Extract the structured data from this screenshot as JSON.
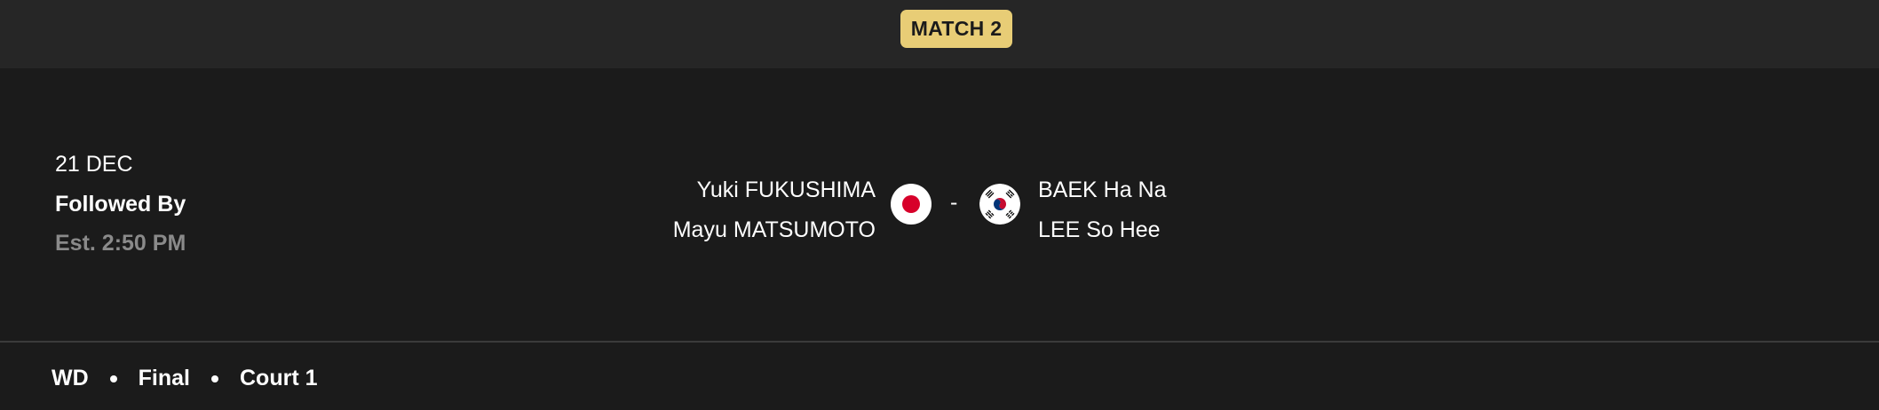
{
  "header": {
    "badge_label": "MATCH 2",
    "badge_color": "#e8cd76"
  },
  "schedule": {
    "date": "21 DEC",
    "followed_by": "Followed By",
    "estimated_time": "Est. 2:50 PM"
  },
  "match": {
    "left_team": {
      "players": [
        "Yuki FUKUSHIMA",
        "Mayu MATSUMOTO"
      ],
      "flag_icon": "japan-flag-icon"
    },
    "separator": "-",
    "right_team": {
      "players": [
        "BAEK Ha Na",
        "LEE So Hee"
      ],
      "flag_icon": "south-korea-flag-icon"
    }
  },
  "footer": {
    "event": "WD",
    "round": "Final",
    "court": "Court 1"
  }
}
